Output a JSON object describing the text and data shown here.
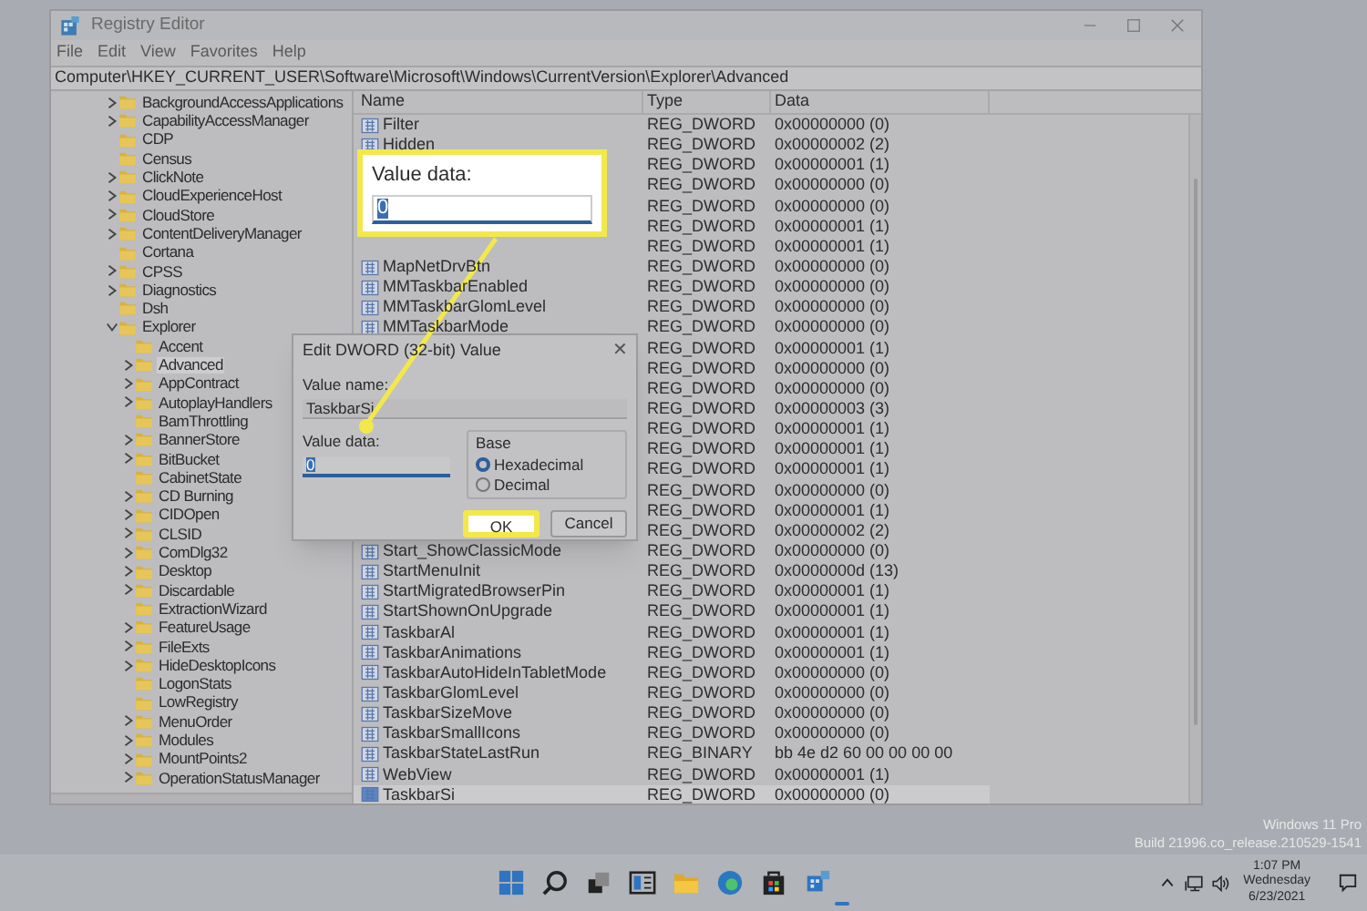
{
  "window": {
    "title": "Registry Editor"
  },
  "menu": [
    "File",
    "Edit",
    "View",
    "Favorites",
    "Help"
  ],
  "address": "Computer\\HKEY_CURRENT_USER\\Software\\Microsoft\\Windows\\CurrentVersion\\Explorer\\Advanced",
  "tree": [
    {
      "label": "BackgroundAccessApplications",
      "expandable": true,
      "expanded": false,
      "selected": false
    },
    {
      "label": "CapabilityAccessManager",
      "expandable": true,
      "expanded": false,
      "selected": false
    },
    {
      "label": "CDP",
      "expandable": false,
      "selected": false
    },
    {
      "label": "Census",
      "expandable": false,
      "selected": false
    },
    {
      "label": "ClickNote",
      "expandable": true,
      "expanded": false,
      "selected": false
    },
    {
      "label": "CloudExperienceHost",
      "expandable": true,
      "expanded": false,
      "selected": false
    },
    {
      "label": "CloudStore",
      "expandable": true,
      "expanded": false,
      "selected": false
    },
    {
      "label": "ContentDeliveryManager",
      "expandable": true,
      "expanded": false,
      "selected": false
    },
    {
      "label": "Cortana",
      "expandable": false,
      "selected": false
    },
    {
      "label": "CPSS",
      "expandable": true,
      "expanded": false,
      "selected": false
    },
    {
      "label": "Diagnostics",
      "expandable": true,
      "expanded": false,
      "selected": false
    },
    {
      "label": "Dsh",
      "expandable": false,
      "selected": false
    },
    {
      "label": "Explorer",
      "expandable": true,
      "expanded": true,
      "selected": false,
      "children": [
        {
          "label": "Accent",
          "expandable": false,
          "selected": false
        },
        {
          "label": "Advanced",
          "expandable": true,
          "expanded": false,
          "selected": true
        },
        {
          "label": "AppContract",
          "expandable": true,
          "expanded": false,
          "selected": false
        },
        {
          "label": "AutoplayHandlers",
          "expandable": true,
          "expanded": false,
          "selected": false
        },
        {
          "label": "BamThrottling",
          "expandable": false,
          "selected": false
        },
        {
          "label": "BannerStore",
          "expandable": true,
          "expanded": false,
          "selected": false
        },
        {
          "label": "BitBucket",
          "expandable": true,
          "expanded": false,
          "selected": false
        },
        {
          "label": "CabinetState",
          "expandable": false,
          "selected": false
        },
        {
          "label": "CD Burning",
          "expandable": true,
          "expanded": false,
          "selected": false
        },
        {
          "label": "CIDOpen",
          "expandable": true,
          "expanded": false,
          "selected": false
        },
        {
          "label": "CLSID",
          "expandable": true,
          "expanded": false,
          "selected": false
        },
        {
          "label": "ComDlg32",
          "expandable": true,
          "expanded": false,
          "selected": false
        },
        {
          "label": "Desktop",
          "expandable": true,
          "expanded": false,
          "selected": false
        },
        {
          "label": "Discardable",
          "expandable": true,
          "expanded": false,
          "selected": false
        },
        {
          "label": "ExtractionWizard",
          "expandable": false,
          "selected": false
        },
        {
          "label": "FeatureUsage",
          "expandable": true,
          "expanded": false,
          "selected": false
        },
        {
          "label": "FileExts",
          "expandable": true,
          "expanded": false,
          "selected": false
        },
        {
          "label": "HideDesktopIcons",
          "expandable": true,
          "expanded": false,
          "selected": false
        },
        {
          "label": "LogonStats",
          "expandable": false,
          "selected": false
        },
        {
          "label": "LowRegistry",
          "expandable": false,
          "selected": false
        },
        {
          "label": "MenuOrder",
          "expandable": true,
          "expanded": false,
          "selected": false
        },
        {
          "label": "Modules",
          "expandable": true,
          "expanded": false,
          "selected": false
        },
        {
          "label": "MountPoints2",
          "expandable": true,
          "expanded": false,
          "selected": false
        },
        {
          "label": "OperationStatusManager",
          "expandable": true,
          "expanded": false,
          "selected": false
        }
      ]
    }
  ],
  "table": {
    "columns": [
      "Name",
      "Type",
      "Data"
    ],
    "rows": [
      {
        "name": "Filter",
        "type": "REG_DWORD",
        "data": "0x00000000 (0)",
        "selected": false
      },
      {
        "name": "Hidden",
        "type": "REG_DWORD",
        "data": "0x00000002 (2)",
        "selected": false
      },
      {
        "type": "REG_DWORD",
        "data": "0x00000001 (1)",
        "selected": false
      },
      {
        "type": "REG_DWORD",
        "data": "0x00000000 (0)",
        "selected": false
      },
      {
        "type": "REG_DWORD",
        "data": "0x00000000 (0)",
        "selected": false
      },
      {
        "type": "REG_DWORD",
        "data": "0x00000001 (1)",
        "selected": false
      },
      {
        "type": "REG_DWORD",
        "data": "0x00000001 (1)",
        "selected": false
      },
      {
        "name": "MapNetDrvBtn",
        "type": "REG_DWORD",
        "data": "0x00000000 (0)",
        "selected": false
      },
      {
        "name": "MMTaskbarEnabled",
        "type": "REG_DWORD",
        "data": "0x00000000 (0)",
        "selected": false
      },
      {
        "name": "MMTaskbarGlomLevel",
        "type": "REG_DWORD",
        "data": "0x00000000 (0)",
        "selected": false
      },
      {
        "name": "MMTaskbarMode",
        "type": "REG_DWORD",
        "data": "0x00000000 (0)",
        "selected": false
      },
      {
        "type": "REG_DWORD",
        "data": "0x00000001 (1)",
        "selected": false
      },
      {
        "type": "REG_DWORD",
        "data": "0x00000000 (0)",
        "selected": false
      },
      {
        "type": "REG_DWORD",
        "data": "0x00000000 (0)",
        "selected": false
      },
      {
        "type": "REG_DWORD",
        "data": "0x00000003 (3)",
        "selected": false
      },
      {
        "type": "REG_DWORD",
        "data": "0x00000001 (1)",
        "selected": false
      },
      {
        "type": "REG_DWORD",
        "data": "0x00000001 (1)",
        "selected": false
      },
      {
        "type": "REG_DWORD",
        "data": "0x00000001 (1)",
        "selected": false
      },
      {
        "type": "REG_DWORD",
        "data": "0x00000000 (0)",
        "selected": false
      },
      {
        "type": "REG_DWORD",
        "data": "0x00000001 (1)",
        "selected": false
      },
      {
        "type": "REG_DWORD",
        "data": "0x00000002 (2)",
        "selected": false
      },
      {
        "name": "Start_ShowClassicMode",
        "type": "REG_DWORD",
        "data": "0x00000000 (0)",
        "selected": false
      },
      {
        "name": "StartMenuInit",
        "type": "REG_DWORD",
        "data": "0x0000000d (13)",
        "selected": false
      },
      {
        "name": "StartMigratedBrowserPin",
        "type": "REG_DWORD",
        "data": "0x00000001 (1)",
        "selected": false
      },
      {
        "name": "StartShownOnUpgrade",
        "type": "REG_DWORD",
        "data": "0x00000001 (1)",
        "selected": false
      },
      {
        "name": "TaskbarAl",
        "type": "REG_DWORD",
        "data": "0x00000001 (1)",
        "selected": false
      },
      {
        "name": "TaskbarAnimations",
        "type": "REG_DWORD",
        "data": "0x00000001 (1)",
        "selected": false
      },
      {
        "name": "TaskbarAutoHideInTabletMode",
        "type": "REG_DWORD",
        "data": "0x00000000 (0)",
        "selected": false
      },
      {
        "name": "TaskbarGlomLevel",
        "type": "REG_DWORD",
        "data": "0x00000000 (0)",
        "selected": false
      },
      {
        "name": "TaskbarSizeMove",
        "type": "REG_DWORD",
        "data": "0x00000000 (0)",
        "selected": false
      },
      {
        "name": "TaskbarSmallIcons",
        "type": "REG_DWORD",
        "data": "0x00000000 (0)",
        "selected": false
      },
      {
        "name": "TaskbarStateLastRun",
        "type": "REG_BINARY",
        "data": "bb 4e d2 60 00 00 00 00",
        "selected": false
      },
      {
        "name": "WebView",
        "type": "REG_DWORD",
        "data": "0x00000001 (1)",
        "selected": false
      },
      {
        "name": "TaskbarSi",
        "type": "REG_DWORD",
        "data": "0x00000000 (0)",
        "selected": true
      }
    ]
  },
  "dialog": {
    "title": "Edit DWORD (32-bit) Value",
    "close": "✕",
    "value_name_label": "Value name:",
    "value_name": "TaskbarSi",
    "value_data_label": "Value data:",
    "value_data": "0",
    "base_label": "Base",
    "bases": [
      {
        "label": "Hexadecimal",
        "selected": true
      },
      {
        "label": "Decimal",
        "selected": false
      }
    ],
    "buttons": [
      {
        "label": "OK",
        "highlighted": true
      },
      {
        "label": "Cancel",
        "highlighted": false
      }
    ]
  },
  "callout": {
    "label": "Value data:",
    "value": "0"
  },
  "watermark": [
    "Windows 11 Pro",
    "Build 21996.co_release.210529-1541"
  ],
  "clock": {
    "time": "1:07 PM",
    "day": "Wednesday",
    "date": "6/23/2021"
  }
}
